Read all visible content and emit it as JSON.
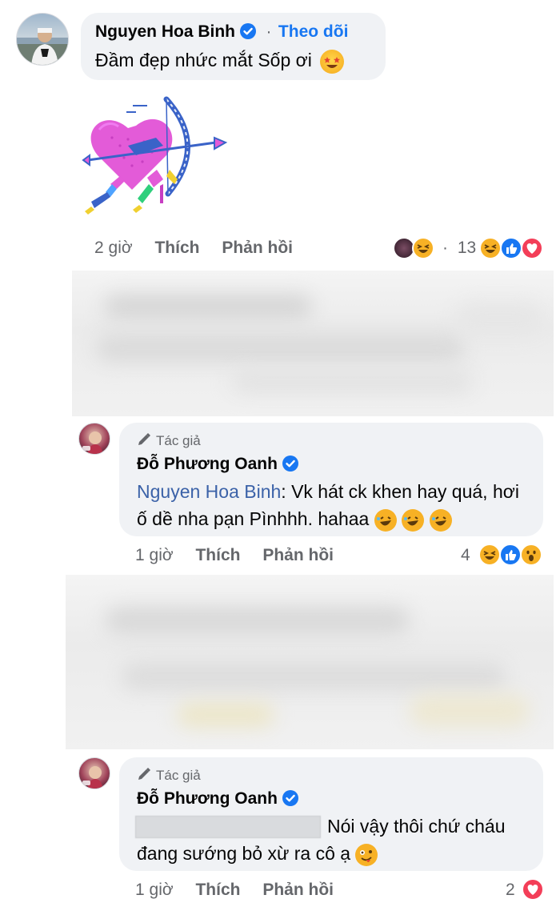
{
  "comment1": {
    "author": "Nguyen Hoa Binh",
    "follow_separator": "·",
    "follow_label": "Theo dõi",
    "text": "Đầm đẹp nhức mắt Sốp ơi",
    "time": "2 giờ",
    "like_label": "Thích",
    "reply_label": "Phản hồi",
    "replier_sep": "·",
    "reaction_count": "13",
    "sticker_icon": "cupid-heart-sticker",
    "emoji_icon": "star-struck-emoji"
  },
  "reply1": {
    "badge_label": "Tác giả",
    "author": "Đỗ Phương Oanh",
    "mention": "Nguyen Hoa Binh",
    "text": ": Vk hát ck khen hay quá, hơi ố dề nha pạn Pìnhhh. hahaa",
    "time": "1 giờ",
    "like_label": "Thích",
    "reply_label": "Phản hồi",
    "reaction_count": "4"
  },
  "reply2": {
    "badge_label": "Tác giả",
    "author": "Đỗ Phương Oanh",
    "text": "Nói vậy thôi chứ cháu đang sướng bỏ xừ ra cô ạ",
    "time": "1 giờ",
    "like_label": "Thích",
    "reply_label": "Phản hồi",
    "reaction_count": "2"
  },
  "colors": {
    "bubble": "#f0f2f5",
    "meta": "#65676b",
    "link_blue": "#3b62a8",
    "verified_blue": "#1877f2",
    "like_blue": "#1877f2",
    "love_red": "#f33e58",
    "haha_yellow": "#f7b125"
  }
}
